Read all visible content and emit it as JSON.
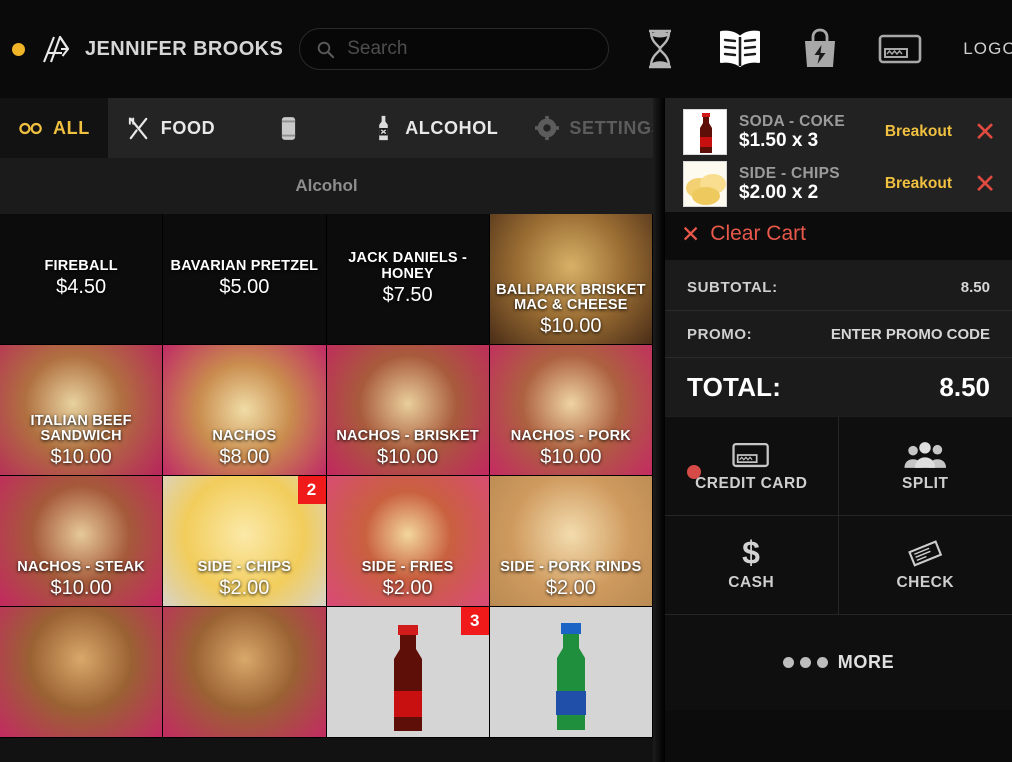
{
  "header": {
    "status_dot_color": "#f0b429",
    "logo_name": "logo-a-icon",
    "user_name": "JENNIFER BROOKS",
    "search": {
      "value": "",
      "placeholder": "Search"
    },
    "icons": [
      {
        "name": "hourglass-icon"
      },
      {
        "name": "open-book-icon"
      },
      {
        "name": "shopping-bag-bolt-icon"
      },
      {
        "name": "credit-card-icon"
      }
    ],
    "logout_label": "LOGOUT"
  },
  "tabs": [
    {
      "label": "ALL",
      "icon": "infinity-icon",
      "active": true,
      "dim": false
    },
    {
      "label": "FOOD",
      "icon": "fork-knife-icon",
      "active": false,
      "dim": false
    },
    {
      "label": "",
      "icon": "soda-can-icon",
      "active": false,
      "dim": false
    },
    {
      "label": "ALCOHOL",
      "icon": "liquor-bottle-icon",
      "active": false,
      "dim": false
    },
    {
      "label": "SETTINGS",
      "icon": "gear-icon",
      "active": false,
      "dim": true
    }
  ],
  "category_header": "Alcohol",
  "products": [
    {
      "name": "FIREBALL",
      "price": "$4.50",
      "image": false,
      "badge": null
    },
    {
      "name": "BAVARIAN PRETZEL",
      "price": "$5.00",
      "image": false,
      "badge": null
    },
    {
      "name": "JACK DANIELS - HONEY",
      "price": "$7.50",
      "image": false,
      "badge": null
    },
    {
      "name": "BALLPARK BRISKET MAC & CHEESE",
      "price": "$10.00",
      "image": true,
      "badge": null
    },
    {
      "name": "ITALIAN BEEF SANDWICH",
      "price": "$10.00",
      "image": true,
      "badge": null
    },
    {
      "name": "NACHOS",
      "price": "$8.00",
      "image": true,
      "badge": null
    },
    {
      "name": "NACHOS - BRISKET",
      "price": "$10.00",
      "image": true,
      "badge": null
    },
    {
      "name": "NACHOS - PORK",
      "price": "$10.00",
      "image": true,
      "badge": null
    },
    {
      "name": "NACHOS - STEAK",
      "price": "$10.00",
      "image": true,
      "badge": null
    },
    {
      "name": "SIDE - CHIPS",
      "price": "$2.00",
      "image": true,
      "badge": "2"
    },
    {
      "name": "SIDE - FRIES",
      "price": "$2.00",
      "image": true,
      "badge": null
    },
    {
      "name": "SIDE - PORK RINDS",
      "price": "$2.00",
      "image": true,
      "badge": null
    },
    {
      "name": "",
      "price": "",
      "image": true,
      "badge": null
    },
    {
      "name": "",
      "price": "",
      "image": true,
      "badge": null
    },
    {
      "name": "",
      "price": "",
      "image": true,
      "badge": "3"
    },
    {
      "name": "",
      "price": "",
      "image": true,
      "badge": null
    }
  ],
  "cart": {
    "items": [
      {
        "name": "SODA - COKE",
        "price_qty": "$1.50 x 3",
        "action_label": "Breakout",
        "thumb": "coke-bottle-thumb",
        "remove_icon": "remove-icon"
      },
      {
        "name": "SIDE - CHIPS",
        "price_qty": "$2.00 x 2",
        "action_label": "Breakout",
        "thumb": "chips-thumb",
        "remove_icon": "remove-icon"
      }
    ],
    "clear_label": "Clear Cart"
  },
  "totals": {
    "subtotal_label": "SUBTOTAL:",
    "subtotal_value": "8.50",
    "promo_label": "PROMO:",
    "promo_value": "ENTER PROMO CODE",
    "total_label": "TOTAL:",
    "total_value": "8.50"
  },
  "payment": {
    "buttons": [
      {
        "label": "CREDIT CARD",
        "icon": "credit-card-icon",
        "selected": true
      },
      {
        "label": "SPLIT",
        "icon": "people-group-icon",
        "selected": false
      },
      {
        "label": "CASH",
        "icon": "dollar-sign-icon",
        "selected": false
      },
      {
        "label": "CHECK",
        "icon": "check-paper-icon",
        "selected": false
      }
    ],
    "more_label": "MORE"
  },
  "colors": {
    "accent_yellow": "#f0c040",
    "danger_red": "#e8584b",
    "badge_red": "#f01a1a",
    "selected_dot": "#d64b47"
  }
}
